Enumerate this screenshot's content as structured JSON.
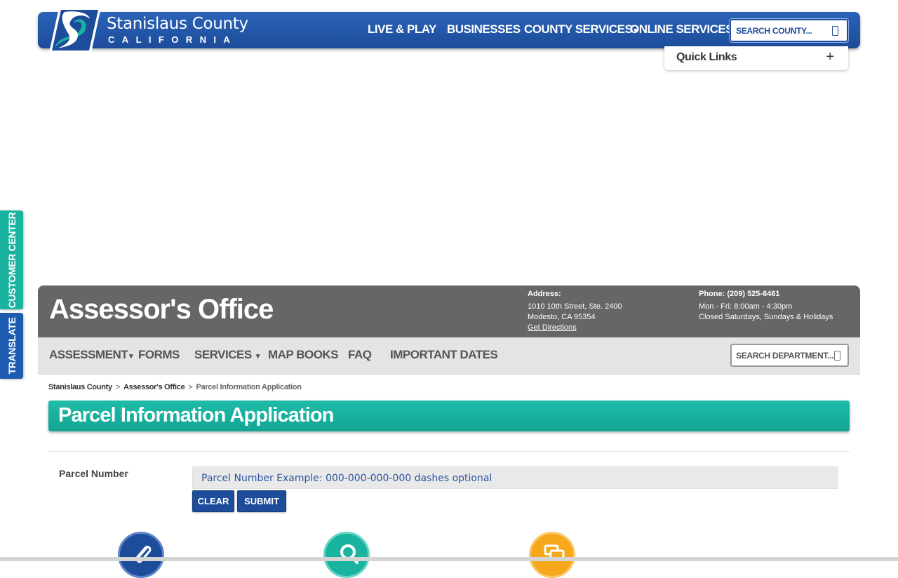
{
  "header": {
    "logo_title": "Stanislaus County",
    "logo_subtitle": "CALIFORNIA",
    "nav": [
      {
        "label": "LIVE & PLAY",
        "has_caret": false
      },
      {
        "label": "BUSINESSES",
        "has_caret": false
      },
      {
        "label": "COUNTY SERVICES",
        "has_caret": true
      },
      {
        "label": "ONLINE SERVICES",
        "has_caret": true
      }
    ],
    "search_placeholder": "SEARCH COUNTY...",
    "accent_color": "#1d4c9a"
  },
  "quick_links": {
    "label": "Quick Links",
    "toggle": "+"
  },
  "side_tabs": {
    "customer_center": "CUSTOMER CENTER",
    "translate": "TRANSLATE"
  },
  "department": {
    "title": "Assessor's Office",
    "address_label": "Address:",
    "address_line1": "1010 10th Street, Ste. 2400",
    "address_line2": "Modesto, CA 95354",
    "directions_link": "Get Directions",
    "phone_label": "Phone: (209) 525-6461",
    "hours_line1": "Mon - Fri: 8:00am - 4:30pm",
    "hours_line2": "Closed Saturdays, Sundays & Holidays"
  },
  "dept_nav": {
    "items": [
      {
        "label": "ASSESSMENT",
        "caret": "▾"
      },
      {
        "label": "FORMS",
        "caret": ""
      },
      {
        "label": "SERVICES",
        "caret": "▾"
      },
      {
        "label": "MAP BOOKS",
        "caret": ""
      },
      {
        "label": "FAQ",
        "caret": ""
      },
      {
        "label": "IMPORTANT DATES",
        "caret": ""
      }
    ],
    "search_placeholder": "SEARCH DEPARTMENT..."
  },
  "breadcrumb": {
    "items": [
      "Stanislaus County",
      "Assessor's Office",
      "Parcel Information Application"
    ],
    "separator": ">"
  },
  "page": {
    "title": "Parcel Information Application",
    "banner_color": "#1ab3a0"
  },
  "form": {
    "parcel_label": "Parcel Number",
    "parcel_placeholder": "Parcel Number Example: 000-000-000-000 dashes optional",
    "clear_label": "CLEAR",
    "submit_label": "SUBMIT"
  },
  "bottom_icons": [
    {
      "icon": "paperclip-icon",
      "color": "#1d4c9a"
    },
    {
      "icon": "search-icon",
      "color": "#1ab3a0"
    },
    {
      "icon": "chat-icon",
      "color": "#f5a81c"
    }
  ]
}
